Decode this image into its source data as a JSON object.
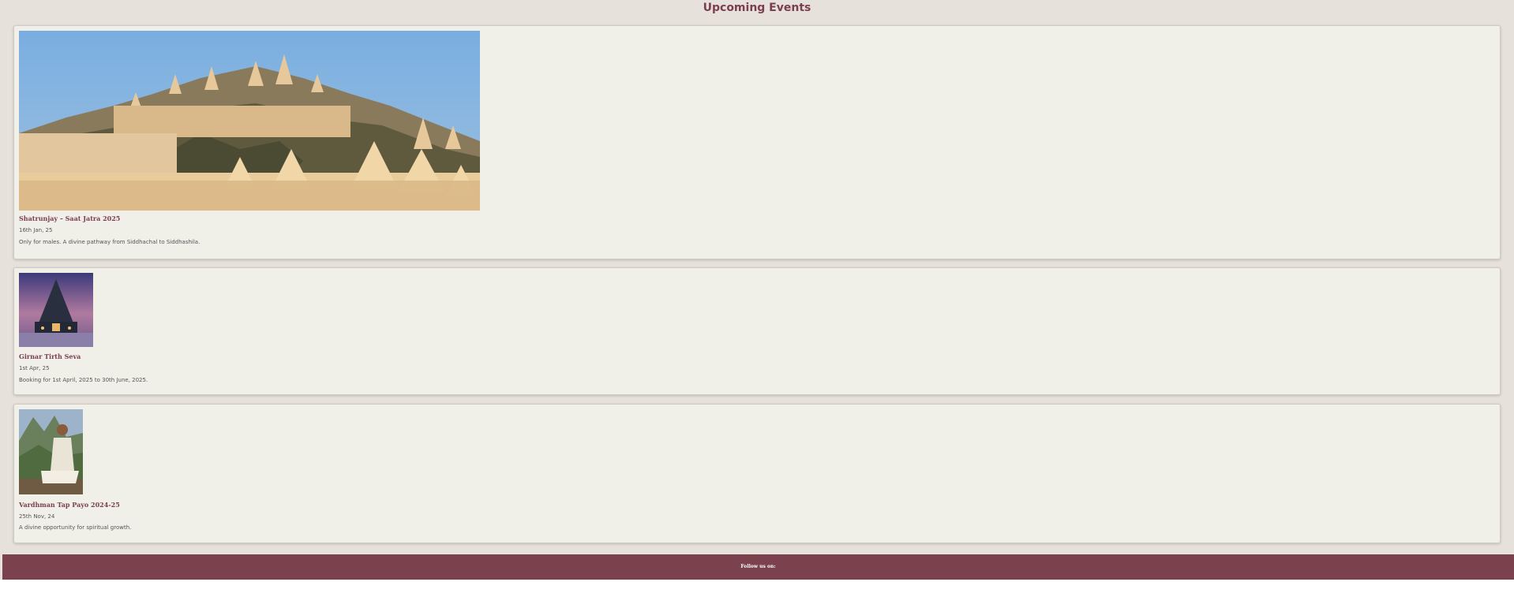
{
  "page": {
    "title": "Upcoming Events"
  },
  "events": [
    {
      "title": "Shatrunjay – Saat Jatra 2025",
      "date": "16th Jan, 25",
      "description": "Only for males. A divine pathway from Siddhachal to Siddhashila.",
      "image": "temple-complex-photo"
    },
    {
      "title": "Girnar Tirth Seva",
      "date": "1st Apr, 25",
      "description": "Booking for 1st April, 2025 to 30th June, 2025.",
      "image": "temple-dusk-photo"
    },
    {
      "title": "Vardhman Tap Payo 2024-25",
      "date": "25th Nov, 24",
      "description": "A divine opportunity for spiritual growth.",
      "image": "meditating-monk-photo"
    }
  ],
  "footer": {
    "follow_label": "Follow us on:"
  },
  "colors": {
    "accent": "#7b3f4d",
    "page_background": "#e6e1da",
    "card_background": "#f0efe8",
    "footer_background": "#7b414d"
  }
}
